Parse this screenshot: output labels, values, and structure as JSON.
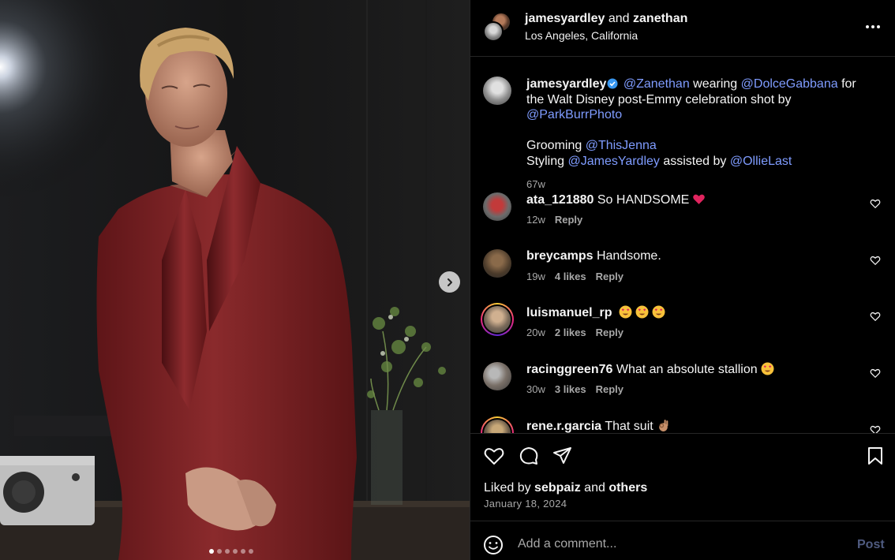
{
  "colors": {
    "background": "#000000",
    "mention": "#7f9cff",
    "muted_text": "#a8a8a8",
    "suit": "#7a1f22",
    "verified": "#3897f0",
    "post_disabled": "#4f5b80"
  },
  "photo": {
    "icon_next": "chevron-right-icon",
    "carousel_count": 6,
    "carousel_active_index": 0
  },
  "header": {
    "user1": "jamesyardley",
    "conjunction": "and",
    "user2": "zanethan",
    "location": "Los Angeles, California",
    "icon_more": "more-horizontal-icon"
  },
  "caption": {
    "username": "jamesyardley",
    "m1": "@Zanethan",
    "t1": " wearing ",
    "m2": "@DolceGabbana",
    "t2": " for the Walt Disney post-Emmy celebration shot by ",
    "m3": "@ParkBurrPhoto",
    "grooming_label": "Grooming ",
    "m4": "@ThisJenna",
    "styling_label": "Styling ",
    "m5": "@JamesYardley",
    "t3": " assisted by ",
    "m6": "@OllieLast",
    "time": "67w"
  },
  "comments": [
    {
      "username": "ata_121880",
      "text": "So HANDSOME",
      "emoji": "red-heart",
      "time": "12w",
      "likes": "",
      "reply": "Reply"
    },
    {
      "username": "breycamps",
      "text": "Handsome.",
      "emoji": "",
      "time": "19w",
      "likes": "4 likes",
      "reply": "Reply"
    },
    {
      "username": "luismanuel_rp",
      "text": "",
      "emoji": "heart-eyes x3",
      "time": "20w",
      "likes": "2 likes",
      "reply": "Reply"
    },
    {
      "username": "racinggreen76",
      "text": "What an absolute stallion",
      "emoji": "heart-eyes",
      "time": "30w",
      "likes": "3 likes",
      "reply": "Reply"
    },
    {
      "username": "rene.r.garcia",
      "text": "That suit",
      "emoji": "ok-hand",
      "time": "",
      "likes": "",
      "reply": ""
    }
  ],
  "actions": {
    "icons": [
      "heart-icon",
      "comment-icon",
      "share-icon",
      "bookmark-icon"
    ],
    "liked_by_prefix": "Liked by ",
    "liked_by_user": "sebpaiz",
    "liked_by_and": " and ",
    "liked_by_others": "others",
    "date": "January 18, 2024"
  },
  "add_comment": {
    "placeholder": "Add a comment...",
    "post_label": "Post",
    "icon": "emoji-icon"
  }
}
